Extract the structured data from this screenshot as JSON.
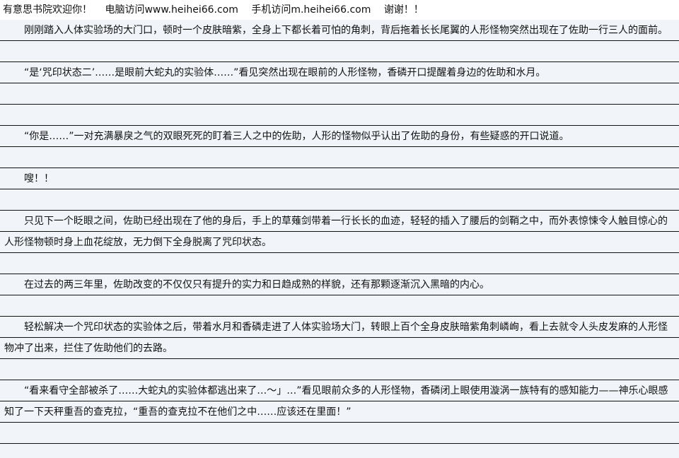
{
  "banner": {
    "site_welcome": "有意思书院欢迎你！",
    "pc_visit": "电脑访问www.heihei66.com",
    "mobile_visit": "手机访问m.heihei66.com",
    "thanks": "谢谢！！"
  },
  "paragraphs": [
    "刚刚踏入人体实验场的大门口，顿时一个皮肤暗紫，全身上下都长着可怕的角刺，背后拖着长长尾翼的人形怪物突然出现在了佐助一行三人的面前。",
    "“是‘咒印状态二’……是眼前大蛇丸的实验体……”看见突然出现在眼前的人形怪物，香磷开口提醒着身边的佐助和水月。",
    "“你是……”一对充满暴戾之气的双眼死死的盯着三人之中的佐助，人形的怪物似乎认出了佐助的身份，有些疑惑的开口说道。",
    "嗖！！",
    "只见下一个眨眼之间，佐助已经出现在了他的身后，手上的草薙剑带着一行长长的血迹，轻轻的插入了腰后的剑鞘之中，而外表惊悚令人触目惊心的人形怪物顿时身上血花绽放，无力倒下全身脱离了咒印状态。",
    "在过去的两三年里，佐助改变的不仅仅只有提升的实力和日趋成熟的样貌，还有那颗逐渐沉入黑暗的内心。",
    "轻松解决一个咒印状态的实验体之后，带着水月和香磷走进了人体实验场大门，转眼上百个全身皮肤暗紫角刺嶙峋，看上去就令人头皮发麻的人形怪物冲了出来，拦住了佐助他们的去路。",
    "“看来看守全部被杀了……大蛇丸的实验体都逃出来了…～」…”看见眼前众多的人形怪物，香磷闭上眼使用漩涡一族特有的感知能力——神乐心眼感知了一下天秤重吾的查克拉，“重吾的查克拉不在他们之中……应该还在里面！”"
  ]
}
